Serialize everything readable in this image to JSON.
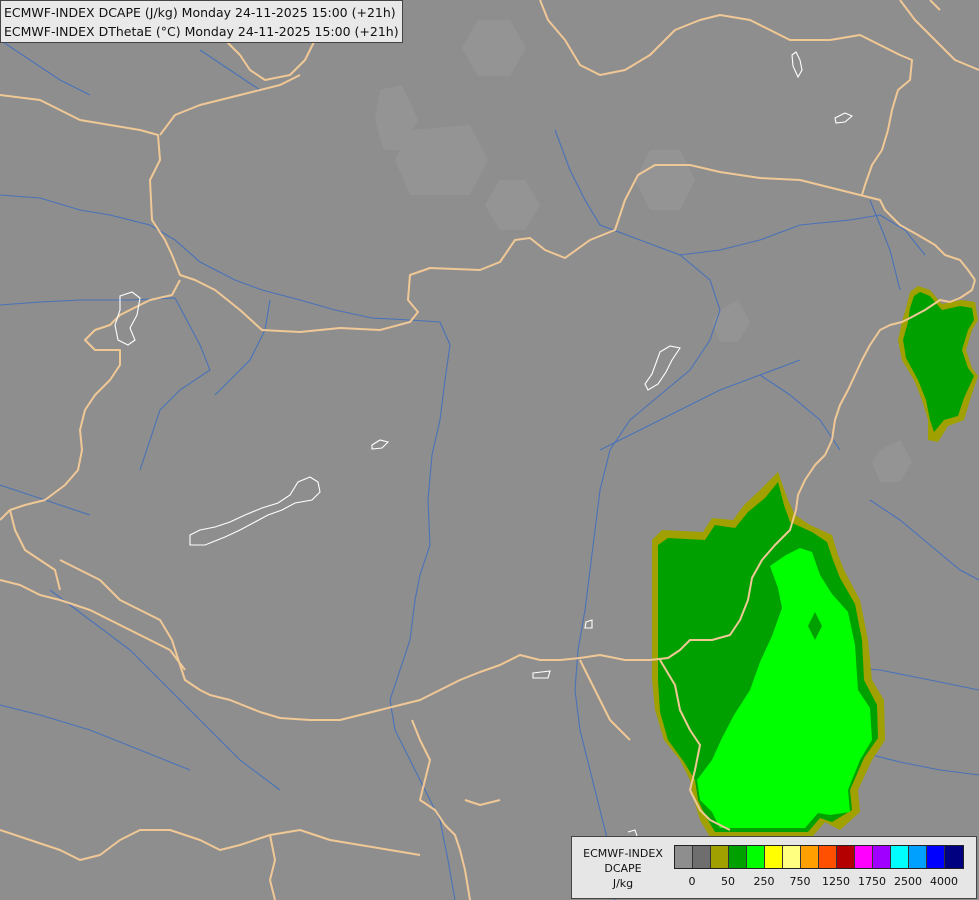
{
  "titles": {
    "line1": "ECMWF-INDEX DCAPE (J/kg) Monday 24-11-2025 15:00 (+21h)",
    "line2": "ECMWF-INDEX DThetaE (°C) Monday 24-11-2025 15:00 (+21h)"
  },
  "legend": {
    "line1": "ECMWF-INDEX",
    "line2": "DCAPE",
    "line3": "J/kg",
    "colors": [
      "#8e8e8e",
      "#6e6e6e",
      "#a0a000",
      "#00a000",
      "#00ff00",
      "#ffff00",
      "#ffff80",
      "#ffa000",
      "#ff5000",
      "#b40000",
      "#ff00ff",
      "#a000ff",
      "#00ffff",
      "#00a0ff",
      "#0000ff",
      "#000080"
    ],
    "ticks": [
      "0",
      "50",
      "250",
      "750",
      "1250",
      "1750",
      "2500",
      "4000"
    ]
  },
  "map_colors": {
    "background": "#8e8e8e",
    "borders": "#f0c896",
    "rivers": "#4a72b8",
    "lakes": "#ffffff",
    "dcape_50": "#a0a000",
    "dcape_250": "#00a000",
    "dcape_500": "#00ff00"
  }
}
